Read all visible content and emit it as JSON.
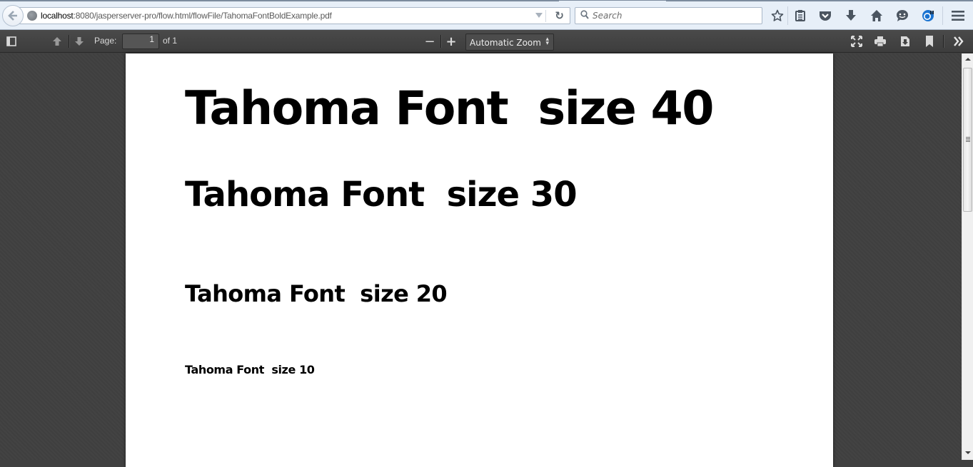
{
  "browser": {
    "url_host": "localhost",
    "url_rest": ":8080/jasperserver-pro/flow.html/flowFile/TahomaFontBoldExample.pdf",
    "search_placeholder": "Search",
    "toolbar_icons": [
      "bookmark-star-icon",
      "reading-list-icon",
      "pocket-icon",
      "downloads-icon",
      "home-icon",
      "chat-icon",
      "firefox-sync-icon",
      "menu-icon"
    ]
  },
  "pdf_toolbar": {
    "page_label": "Page:",
    "page_number": "1",
    "page_total": "of 1",
    "zoom_option": "Automatic Zoom",
    "zoom_out": "−",
    "zoom_in": "+"
  },
  "document": {
    "lines": [
      "Tahoma Font  size 40",
      "Tahoma Font  size 30",
      "Tahoma Font  size 20",
      "Tahoma Font  size 10"
    ]
  },
  "colors": {
    "chrome_bg": "#e7eff8",
    "pdf_toolbar_bg": "#474747",
    "viewer_bg": "#404040",
    "page_bg": "#ffffff",
    "text": "#000000"
  }
}
